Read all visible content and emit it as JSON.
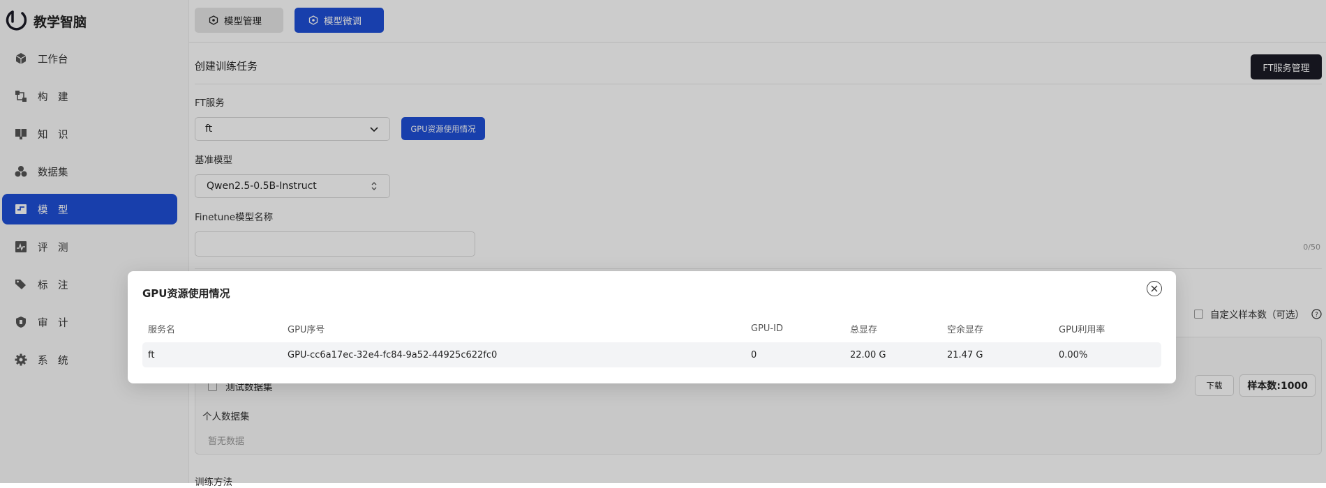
{
  "app": {
    "name": "教学智脑"
  },
  "sidebar": {
    "items": [
      {
        "label": "工作台",
        "icon": "cube-icon",
        "active": false
      },
      {
        "label": "构　建",
        "icon": "build-icon",
        "active": false
      },
      {
        "label": "知　识",
        "icon": "book-icon",
        "active": false
      },
      {
        "label": "数据集",
        "icon": "dataset-icon",
        "active": false
      },
      {
        "label": "模　型",
        "icon": "model-icon",
        "active": true
      },
      {
        "label": "评　测",
        "icon": "chart-icon",
        "active": false
      },
      {
        "label": "标　注",
        "icon": "tag-icon",
        "active": false
      },
      {
        "label": "审　计",
        "icon": "shield-icon",
        "active": false
      },
      {
        "label": "系　统",
        "icon": "gear-icon",
        "active": false
      }
    ]
  },
  "topbar": {
    "tabs": [
      {
        "label": "模型管理",
        "active": false
      },
      {
        "label": "模型微调",
        "active": true
      }
    ]
  },
  "form": {
    "section_title": "创建训练任务",
    "ft_manage_label": "FT服务管理",
    "ft_service_label": "FT服务",
    "ft_service_value": "ft",
    "gpu_button_label": "GPU资源使用情况",
    "base_model_label": "基准模型",
    "base_model_value": "Qwen2.5-0.5B-Instruct",
    "finetune_name_label": "Finetune模型名称",
    "finetune_name_value": "",
    "finetune_name_counter": "0/50",
    "custom_samples_label": "自定义样本数（可选）",
    "test_dataset_label": "测试数据集",
    "download_label": "下载",
    "sample_count_label": "样本数:1000",
    "personal_dataset_label": "个人数据集",
    "no_data_label": "暂无数据",
    "train_method_label": "训练方法"
  },
  "modal": {
    "title": "GPU资源使用情况",
    "columns": [
      "服务名",
      "GPU序号",
      "GPU-ID",
      "总显存",
      "空余显存",
      "GPU利用率"
    ],
    "rows": [
      [
        "ft",
        "GPU-cc6a17ec-32e4-fc84-9a52-44925c622fc0",
        "0",
        "22.00 G",
        "21.47 G",
        "0.00%"
      ]
    ]
  },
  "colors": {
    "primary": "#1f4fd8",
    "dark_button": "#1b1b26",
    "overlay": "rgba(0,0,0,0.2)"
  }
}
